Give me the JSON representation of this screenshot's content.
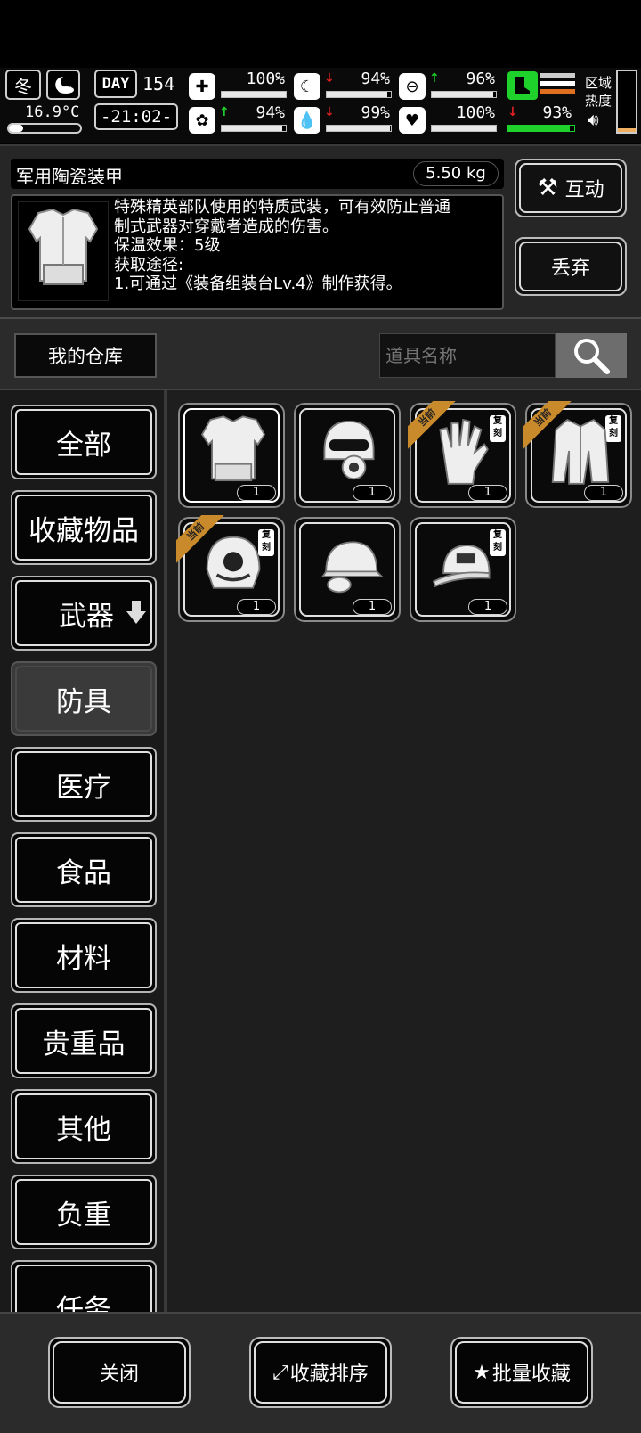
{
  "status": {
    "season": "冬",
    "temperature": "16.9°C",
    "day_label": "DAY",
    "day_number": "154",
    "time": "-21:02-",
    "stats": [
      {
        "name": "health",
        "icon": "medkit-icon",
        "value": "100%",
        "trend": "none",
        "level": 1.0
      },
      {
        "name": "hunger",
        "icon": "stomach-icon",
        "value": "94%",
        "trend": "down",
        "level": 0.94
      },
      {
        "name": "mood",
        "icon": "pill-icon",
        "value": "96%",
        "trend": "up",
        "level": 0.96
      },
      {
        "name": "sanity",
        "icon": "brain-icon",
        "value": "94%",
        "trend": "up",
        "level": 0.94
      },
      {
        "name": "thirst",
        "icon": "water-drop-icon",
        "value": "99%",
        "trend": "down",
        "level": 0.99
      },
      {
        "name": "heart",
        "icon": "heart-icon",
        "value": "100%",
        "trend": "none",
        "level": 1.0
      },
      {
        "name": "stamina",
        "icon": "boot-icon",
        "value": "93%",
        "trend": "down",
        "level": 0.93
      }
    ],
    "zone_heat_label_1": "区域",
    "zone_heat_label_2": "热度",
    "colors": {
      "stamina_green": "#1fd12b",
      "orange": "#e07020",
      "down": "#e02020"
    }
  },
  "detail": {
    "item_name": "军用陶瓷装甲",
    "item_weight": "5.50 kg",
    "description": "特殊精英部队使用的特质武装，可有效防止普通\n制式武器对穿戴者造成的伤害。\n保温效果：5级\n获取途径:\n1.可通过《装备组装台Lv.4》制作获得。",
    "interact_label": "互动",
    "discard_label": "丢弃"
  },
  "warehouse": {
    "title": "我的仓库",
    "search_placeholder": "道具名称"
  },
  "categories": [
    {
      "label": "全部"
    },
    {
      "label": "收藏物品"
    },
    {
      "label": "武器"
    },
    {
      "label": "防具",
      "active": true
    },
    {
      "label": "医疗"
    },
    {
      "label": "食品"
    },
    {
      "label": "材料"
    },
    {
      "label": "贵重品"
    },
    {
      "label": "其他"
    },
    {
      "label": "负重"
    },
    {
      "label": "任务"
    }
  ],
  "items": [
    {
      "name": "ceramic-armor",
      "count": "1",
      "current": false,
      "copy": false,
      "selected": true
    },
    {
      "name": "gas-mask-helmet",
      "count": "1",
      "current": false,
      "copy": false
    },
    {
      "name": "gloves",
      "count": "1",
      "current": true,
      "copy": true
    },
    {
      "name": "coat",
      "count": "1",
      "current": true,
      "copy": true
    },
    {
      "name": "tactical-helmet",
      "count": "1",
      "current": true,
      "copy": true
    },
    {
      "name": "cap-with-mic",
      "count": "1",
      "current": false,
      "copy": false
    },
    {
      "name": "baseball-cap",
      "count": "1",
      "current": false,
      "copy": true
    }
  ],
  "tags": {
    "current": "当前",
    "copy_1": "复",
    "copy_2": "刻"
  },
  "bottom": {
    "close_label": "关闭",
    "sort_label": "收藏排序",
    "batch_label": "批量收藏"
  }
}
